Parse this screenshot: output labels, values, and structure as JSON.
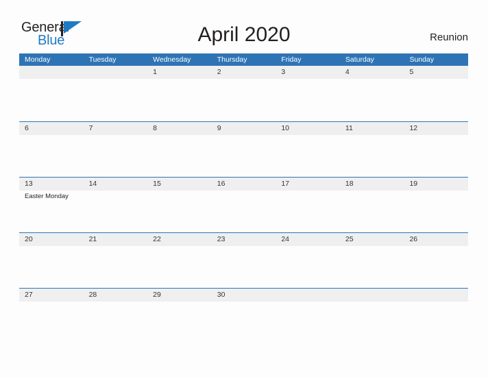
{
  "brand": {
    "word_top": "General",
    "word_bottom": "Blue",
    "flag_icon": "flag-icon",
    "dark_color": "#231f20",
    "blue_color": "#1f7ac4"
  },
  "header": {
    "title": "April 2020",
    "location": "Reunion"
  },
  "calendar": {
    "accent_color": "#2e74b5",
    "band_color": "#efefef",
    "weekdays": [
      "Monday",
      "Tuesday",
      "Wednesday",
      "Thursday",
      "Friday",
      "Saturday",
      "Sunday"
    ],
    "weeks": [
      {
        "days": [
          {
            "num": "",
            "events": []
          },
          {
            "num": "",
            "events": []
          },
          {
            "num": "1",
            "events": []
          },
          {
            "num": "2",
            "events": []
          },
          {
            "num": "3",
            "events": []
          },
          {
            "num": "4",
            "events": []
          },
          {
            "num": "5",
            "events": []
          }
        ]
      },
      {
        "days": [
          {
            "num": "6",
            "events": []
          },
          {
            "num": "7",
            "events": []
          },
          {
            "num": "8",
            "events": []
          },
          {
            "num": "9",
            "events": []
          },
          {
            "num": "10",
            "events": []
          },
          {
            "num": "11",
            "events": []
          },
          {
            "num": "12",
            "events": []
          }
        ]
      },
      {
        "days": [
          {
            "num": "13",
            "events": [
              "Easter Monday"
            ]
          },
          {
            "num": "14",
            "events": []
          },
          {
            "num": "15",
            "events": []
          },
          {
            "num": "16",
            "events": []
          },
          {
            "num": "17",
            "events": []
          },
          {
            "num": "18",
            "events": []
          },
          {
            "num": "19",
            "events": []
          }
        ]
      },
      {
        "days": [
          {
            "num": "20",
            "events": []
          },
          {
            "num": "21",
            "events": []
          },
          {
            "num": "22",
            "events": []
          },
          {
            "num": "23",
            "events": []
          },
          {
            "num": "24",
            "events": []
          },
          {
            "num": "25",
            "events": []
          },
          {
            "num": "26",
            "events": []
          }
        ]
      },
      {
        "days": [
          {
            "num": "27",
            "events": []
          },
          {
            "num": "28",
            "events": []
          },
          {
            "num": "29",
            "events": []
          },
          {
            "num": "30",
            "events": []
          },
          {
            "num": "",
            "events": []
          },
          {
            "num": "",
            "events": []
          },
          {
            "num": "",
            "events": []
          }
        ]
      }
    ]
  }
}
